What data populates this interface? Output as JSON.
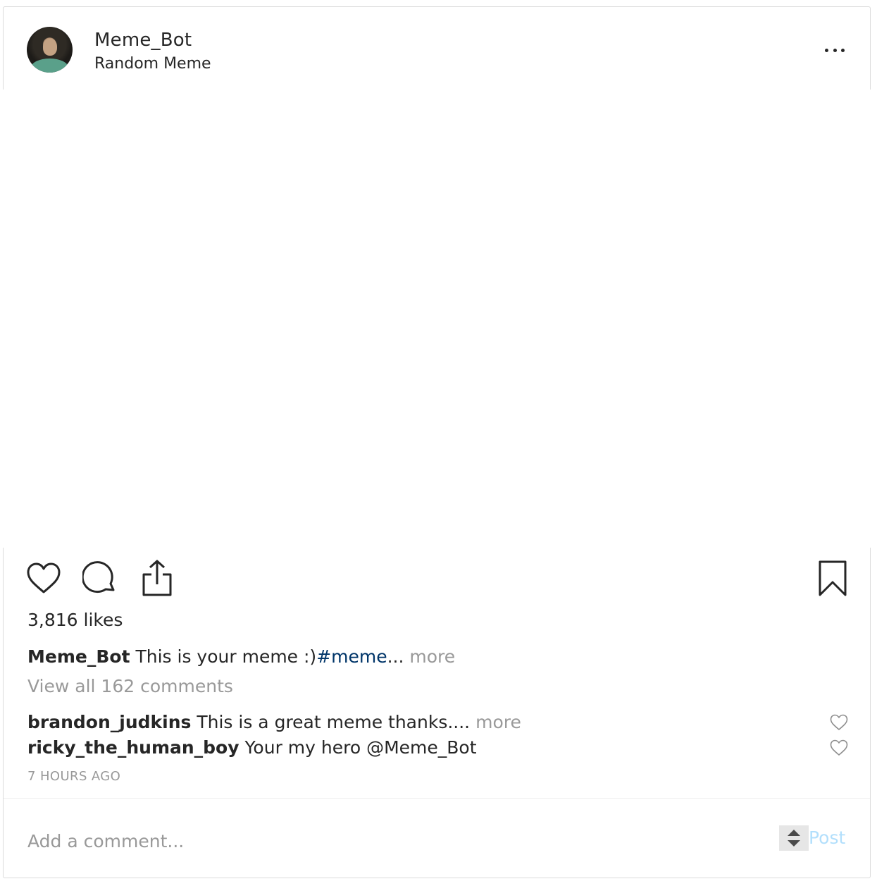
{
  "header": {
    "username": "Meme_Bot",
    "location": "Random Meme",
    "more_icon": "ellipsis-icon"
  },
  "actions": {
    "like_icon": "heart-icon",
    "comment_icon": "speech-bubble-icon",
    "share_icon": "share-icon",
    "save_icon": "bookmark-icon"
  },
  "likes": "3,816 likes",
  "caption": {
    "username": "Meme_Bot",
    "text": " This is your meme :)",
    "hashtag": "#meme",
    "ellipsis": "...",
    "more": "more"
  },
  "view_all": "View all 162 comments",
  "comments": [
    {
      "username": "brandon_judkins",
      "text": " This is a great meme thanks....",
      "more": "more"
    },
    {
      "username": "ricky_the_human_boy",
      "text": " Your my hero @Meme_Bot"
    }
  ],
  "timestamp": "7 HOURS AGO",
  "comment_box": {
    "placeholder": "Add a comment...",
    "post_label": "Post"
  },
  "colors": {
    "text": "#262626",
    "muted": "#999999",
    "hashtag": "#003569",
    "post_disabled": "#b2dffc",
    "border": "#dbdbdb"
  }
}
